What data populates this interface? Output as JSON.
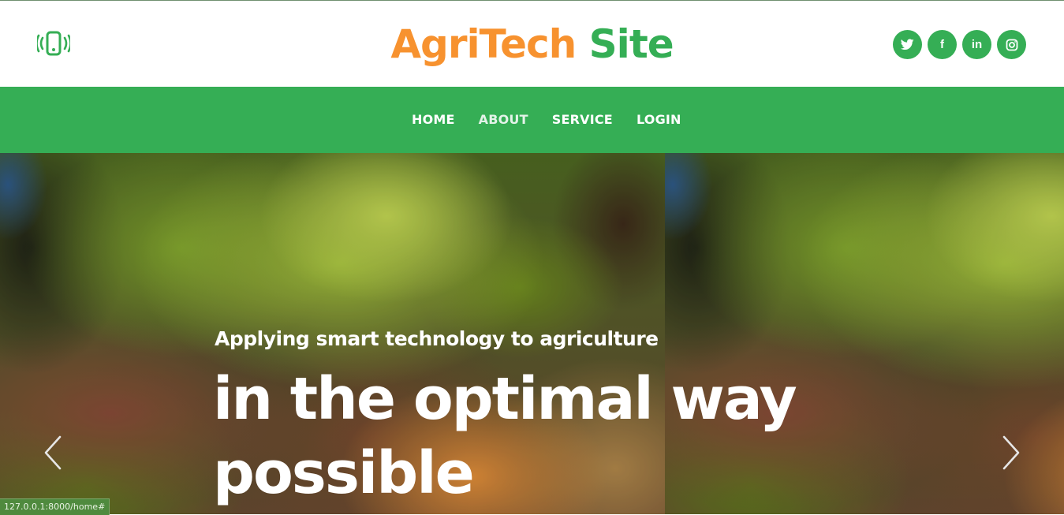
{
  "header": {
    "title_part1": "AgriTech",
    "title_part2": "Site",
    "left_icon": "phone-vibrate-icon",
    "social": [
      {
        "name": "twitter-icon",
        "label": ""
      },
      {
        "name": "facebook-icon",
        "label": "f"
      },
      {
        "name": "linkedin-icon",
        "label": "in"
      },
      {
        "name": "instagram-icon",
        "label": ""
      }
    ]
  },
  "nav": {
    "items": [
      {
        "label": "HOME"
      },
      {
        "label": "ABOUT"
      },
      {
        "label": "SERVICE"
      },
      {
        "label": "LOGIN"
      }
    ]
  },
  "hero": {
    "subtitle": "Applying smart technology to agriculture",
    "title": "in the optimal way possible",
    "prev_icon": "chevron-left-icon",
    "next_icon": "chevron-right-icon"
  },
  "status": {
    "url": "127.0.0.1:8000/home#"
  },
  "colors": {
    "brand_orange": "#f7922f",
    "brand_green": "#35ae55",
    "white": "#ffffff"
  }
}
